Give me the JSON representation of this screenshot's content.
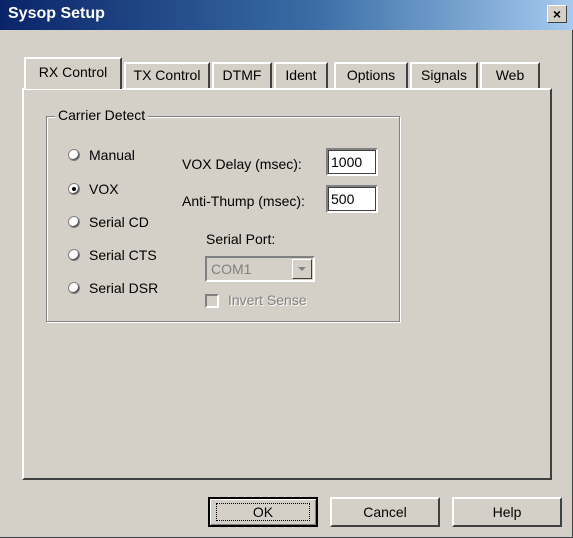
{
  "window": {
    "title": "Sysop Setup",
    "close_label": "×"
  },
  "tabs": [
    {
      "label": "RX Control",
      "active": true
    },
    {
      "label": "TX Control",
      "active": false
    },
    {
      "label": "DTMF",
      "active": false
    },
    {
      "label": "Ident",
      "active": false
    },
    {
      "label": "Options",
      "active": false
    },
    {
      "label": "Signals",
      "active": false
    },
    {
      "label": "Web",
      "active": false
    }
  ],
  "carrier_detect": {
    "legend": "Carrier Detect",
    "options": [
      {
        "label": "Manual",
        "checked": false
      },
      {
        "label": "VOX",
        "checked": true
      },
      {
        "label": "Serial CD",
        "checked": false
      },
      {
        "label": "Serial CTS",
        "checked": false
      },
      {
        "label": "Serial DSR",
        "checked": false
      }
    ],
    "vox_delay_label": "VOX Delay (msec):",
    "vox_delay_value": "1000",
    "anti_thump_label": "Anti-Thump (msec):",
    "anti_thump_value": "500",
    "serial_port_label": "Serial Port:",
    "serial_port_value": "COM1",
    "invert_sense_label": "Invert Sense"
  },
  "buttons": {
    "ok": "OK",
    "cancel": "Cancel",
    "help": "Help"
  }
}
